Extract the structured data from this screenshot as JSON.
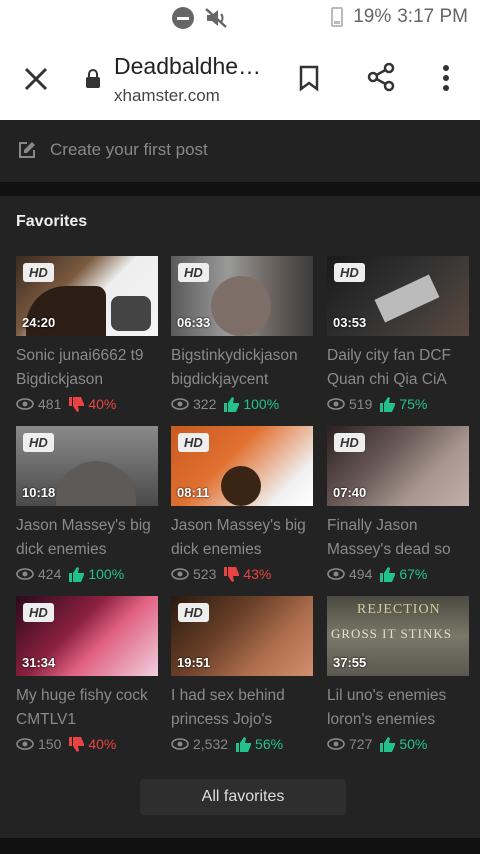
{
  "status": {
    "battery": "19%",
    "time": "3:17 PM"
  },
  "toolbar": {
    "title": "Deadbaldhe…",
    "url": "xhamster.com"
  },
  "post": {
    "placeholder": "Create your first post"
  },
  "favorites": {
    "heading": "Favorites",
    "button": "All favorites",
    "items": [
      {
        "badge": "HD",
        "duration": "24:20",
        "title": "Sonic junai6662 t9 Bigdickjason",
        "views": "481",
        "rating": "40%",
        "positive": false
      },
      {
        "badge": "HD",
        "duration": "06:33",
        "title": "Bigstinkydickjason bigdickjaycent",
        "views": "322",
        "rating": "100%",
        "positive": true
      },
      {
        "badge": "HD",
        "duration": "03:53",
        "title": "Daily city fan DCF Quan chi Qia CiA",
        "views": "519",
        "rating": "75%",
        "positive": true
      },
      {
        "badge": "HD",
        "duration": "10:18",
        "title": "Jason Massey's big dick enemies",
        "views": "424",
        "rating": "100%",
        "positive": true
      },
      {
        "badge": "HD",
        "duration": "08:11",
        "title": "Jason Massey's big dick enemies",
        "views": "523",
        "rating": "43%",
        "positive": false
      },
      {
        "badge": "HD",
        "duration": "07:40",
        "title": "Finally Jason Massey's dead so",
        "views": "494",
        "rating": "67%",
        "positive": true
      },
      {
        "badge": "HD",
        "duration": "31:34",
        "title": "My huge fishy cock CMTLV1",
        "views": "150",
        "rating": "40%",
        "positive": false
      },
      {
        "badge": "HD",
        "duration": "19:51",
        "title": "I had sex behind princess Jojo's",
        "views": "2,532",
        "rating": "56%",
        "positive": true
      },
      {
        "badge": "",
        "duration": "37:55",
        "title": "Lil uno's enemies loron's enemies",
        "views": "727",
        "rating": "50%",
        "positive": true,
        "thumb_text": [
          "REJECTION",
          "GROSS IT STINKS"
        ]
      }
    ]
  },
  "colors": {
    "positive": "#22c38b",
    "negative": "#e84444"
  }
}
